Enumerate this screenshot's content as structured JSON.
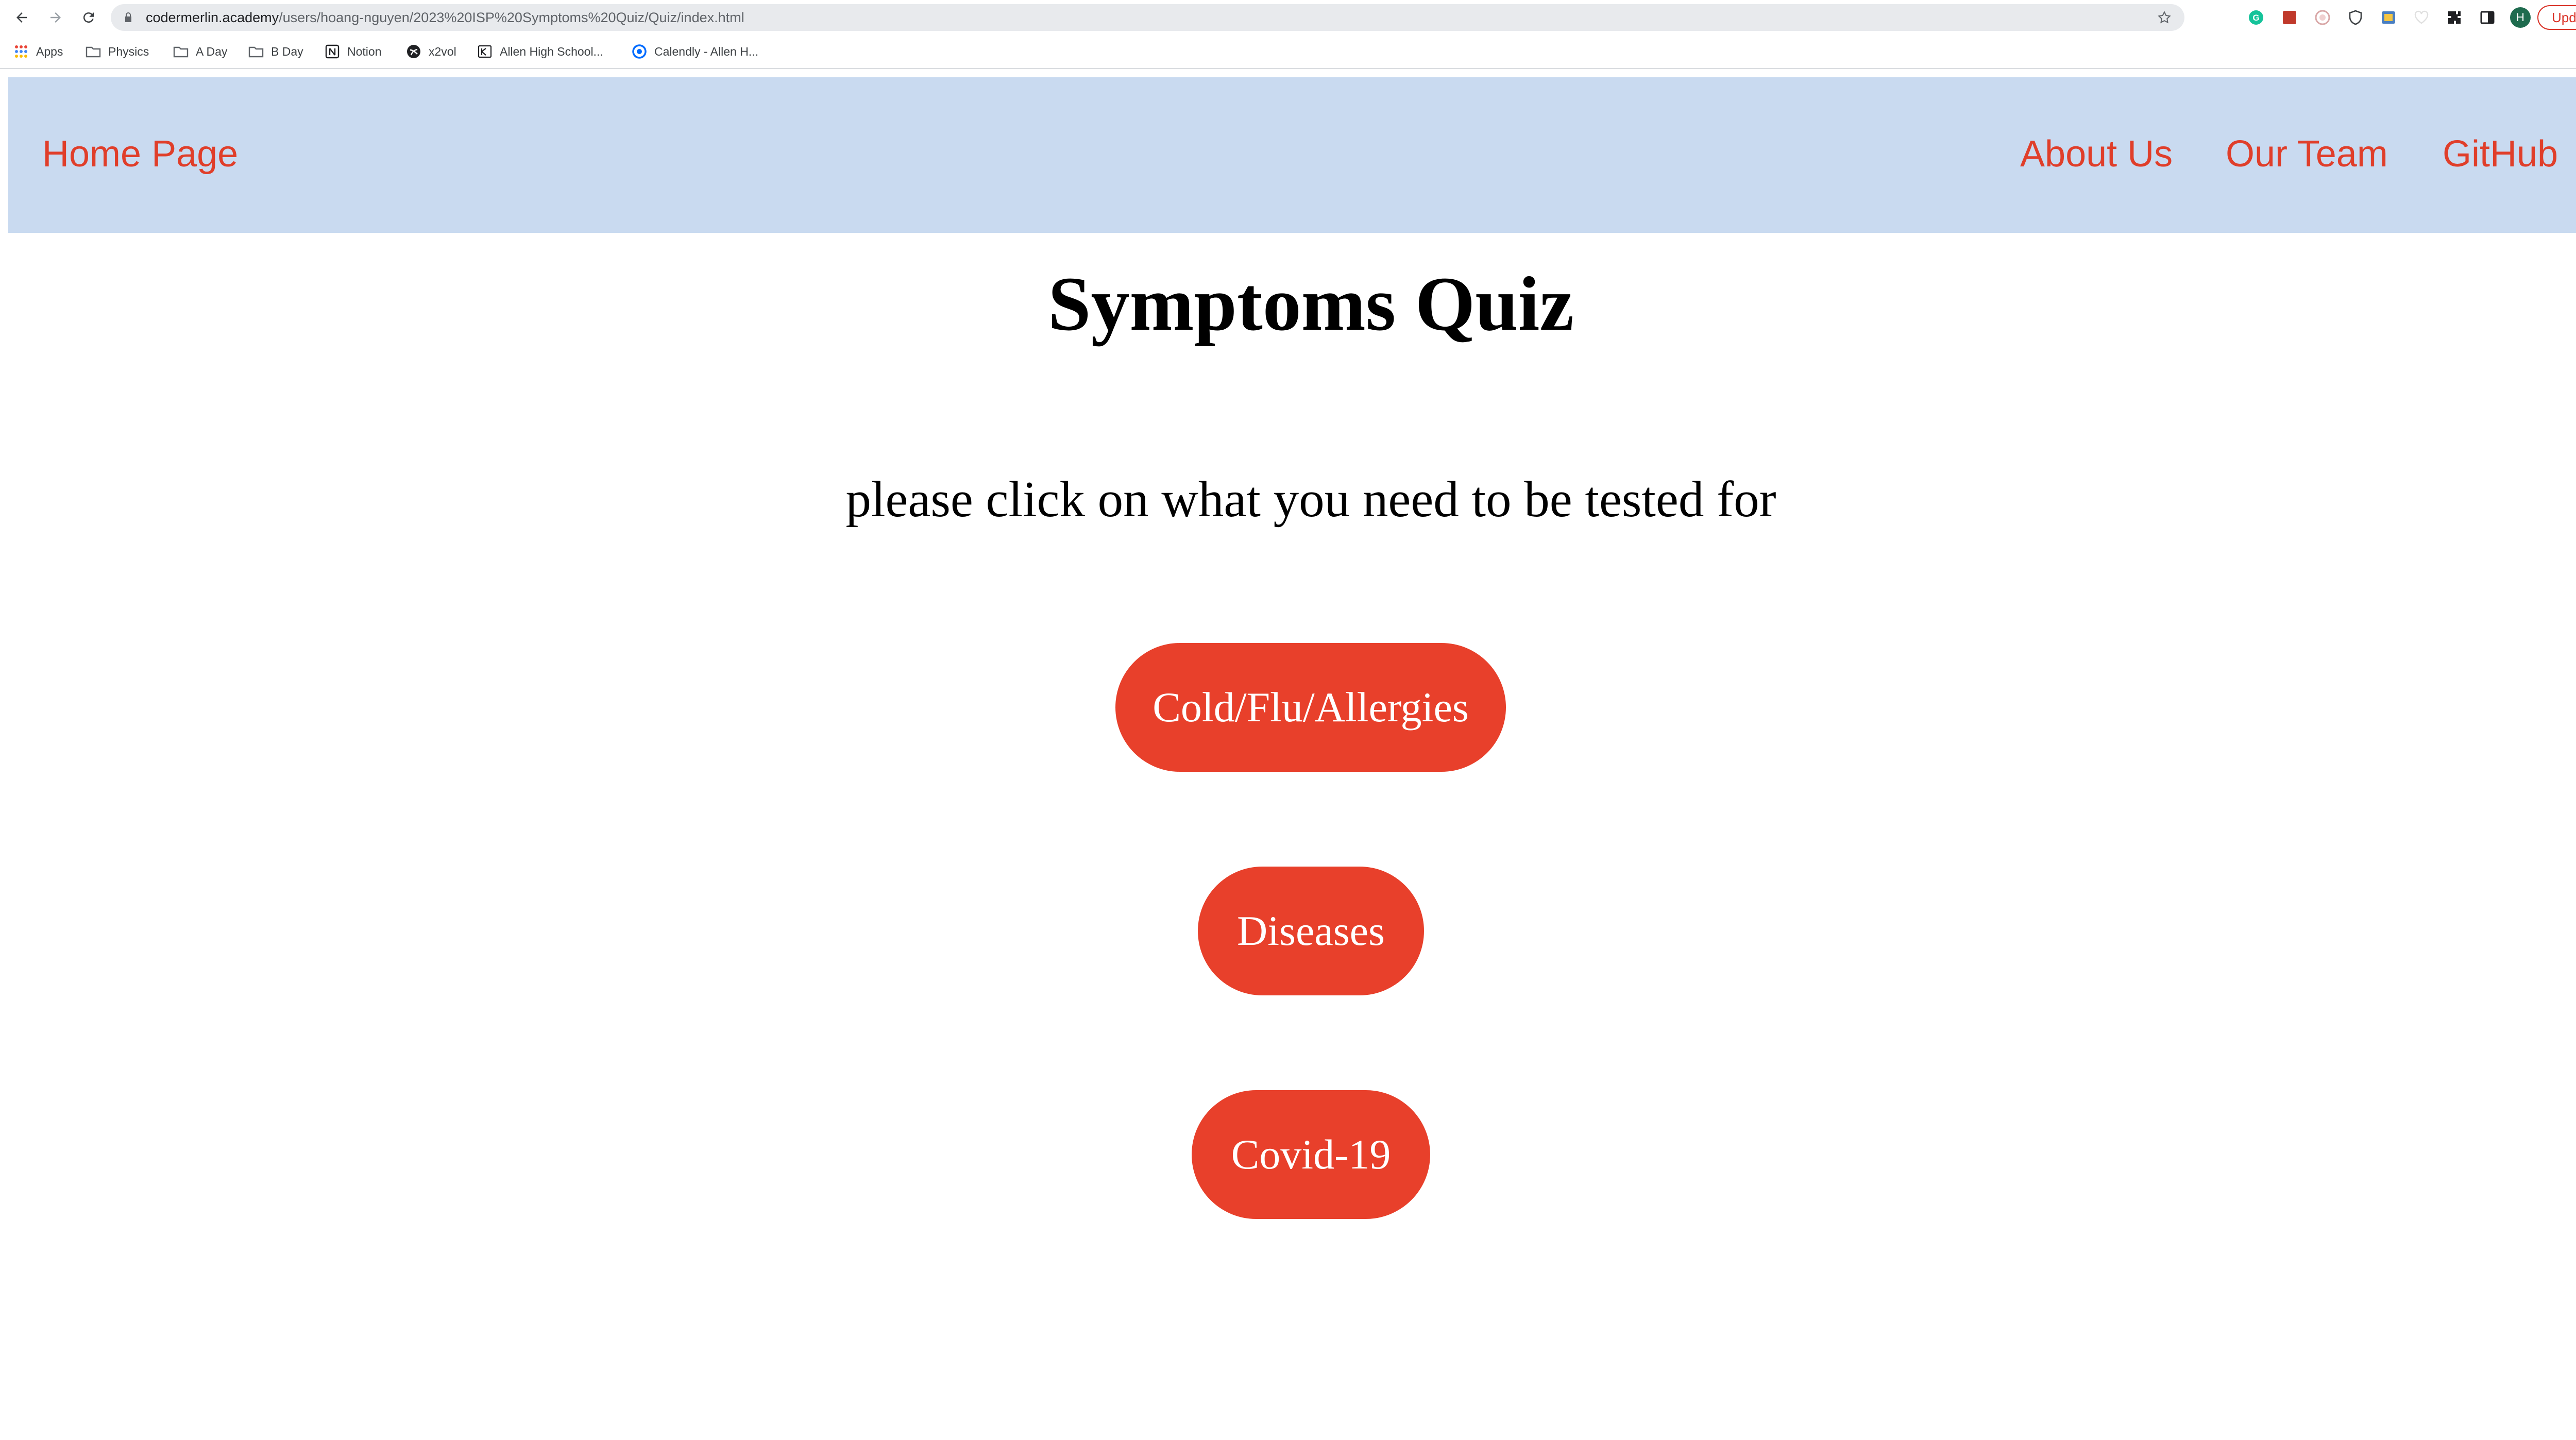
{
  "browser": {
    "url_host": "codermerlin.academy",
    "url_path": "/users/hoang-nguyen/2023%20ISP%20Symptoms%20Quiz/Quiz/index.html",
    "update_label": "Update",
    "menu_glyph": "⋮",
    "profile_initial": "H",
    "bookmarks": [
      {
        "label": "Apps",
        "icon": "apps-grid-icon"
      },
      {
        "label": "Physics",
        "icon": "folder-icon"
      },
      {
        "label": "A Day",
        "icon": "folder-icon"
      },
      {
        "label": "B Day",
        "icon": "folder-icon"
      },
      {
        "label": "Notion",
        "icon": "notion-icon"
      },
      {
        "label": "x2vol",
        "icon": "x2vol-icon"
      },
      {
        "label": "Allen High School...",
        "icon": "allen-icon"
      },
      {
        "label": "Calendly - Allen H...",
        "icon": "calendly-icon"
      }
    ]
  },
  "site_nav": {
    "home": "Home Page",
    "about": "About Us",
    "team": "Our Team",
    "github": "GitHub"
  },
  "main": {
    "title": "Symptoms Quiz",
    "instructions": "please click on what you need to be tested for",
    "buttons": [
      "Cold/Flu/Allergies",
      "Diseases",
      "Covid-19"
    ]
  },
  "colors": {
    "nav_background": "#c9daf0",
    "nav_link": "#e03e2a",
    "button": "#e8402b",
    "button_text": "#ffffff"
  }
}
